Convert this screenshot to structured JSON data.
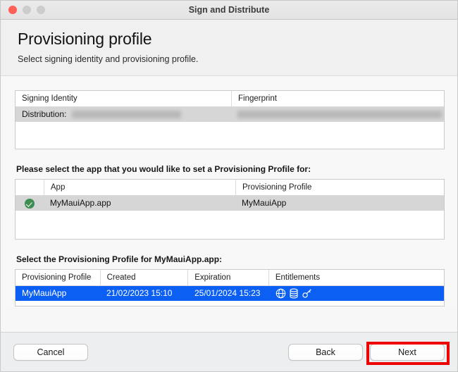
{
  "window": {
    "title": "Sign and Distribute",
    "traffic_lights": [
      "close-button",
      "minimize-button",
      "zoom-button"
    ]
  },
  "header": {
    "title": "Provisioning profile",
    "subtitle": "Select signing identity and provisioning profile."
  },
  "signing_identity_table": {
    "columns": [
      "Signing Identity",
      "Fingerprint"
    ],
    "rows": [
      {
        "signing_identity_prefix": "Distribution:",
        "signing_identity_redacted": true,
        "fingerprint_redacted": true,
        "selected": true
      }
    ]
  },
  "app_section": {
    "label": "Please select the app that you would like to set a Provisioning Profile for:",
    "columns": [
      "",
      "App",
      "Provisioning Profile"
    ],
    "rows": [
      {
        "checked": true,
        "check_icon": "check-circle-icon",
        "app": "MyMauiApp.app",
        "provisioning_profile": "MyMauiApp",
        "selected": true
      }
    ]
  },
  "profile_section": {
    "label": "Select the Provisioning Profile for MyMauiApp.app:",
    "columns": [
      "Provisioning Profile",
      "Created",
      "Expiration",
      "Entitlements"
    ],
    "rows": [
      {
        "profile": "MyMauiApp",
        "created": "21/02/2023 15:10",
        "expiration": "25/01/2024 15:23",
        "entitlement_icons": [
          "network-globe-icon",
          "database-icon",
          "key-icon"
        ],
        "selected": true
      }
    ]
  },
  "footer": {
    "cancel_label": "Cancel",
    "back_label": "Back",
    "next_label": "Next"
  },
  "annotation": {
    "highlight_target": "next-button",
    "highlight_color": "#ef0000"
  },
  "colors": {
    "selection_blue": "#0b5ff2",
    "row_grey": "#d6d6d6",
    "check_green": "#3e8e52",
    "close_red": "#ff5f57"
  }
}
